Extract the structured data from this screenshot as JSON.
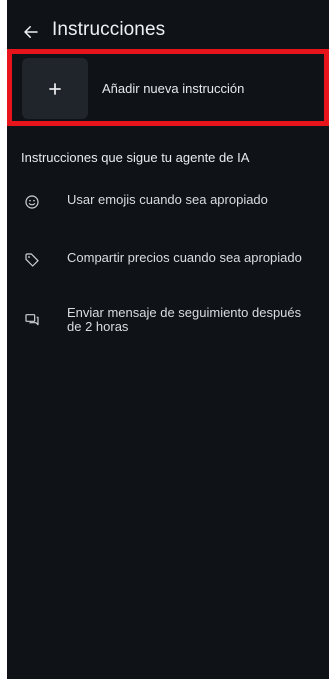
{
  "header": {
    "title": "Instrucciones",
    "back_icon": "arrow-left-icon"
  },
  "add_instruction": {
    "label": "Añadir nueva instrucción",
    "icon": "plus-icon"
  },
  "section": {
    "title": "Instrucciones que sigue tu agente de IA"
  },
  "instructions": [
    {
      "icon": "smiley-icon",
      "text": "Usar emojis cuando sea apropiado"
    },
    {
      "icon": "tag-icon",
      "text": "Compartir precios cuando sea apropiado"
    },
    {
      "icon": "chat-icon",
      "text": "Enviar mensaje de seguimiento después de 2 horas"
    }
  ],
  "colors": {
    "background": "#0f1317",
    "highlight": "#e8141b",
    "tile": "#20252b",
    "text": "#e6e8ea"
  }
}
